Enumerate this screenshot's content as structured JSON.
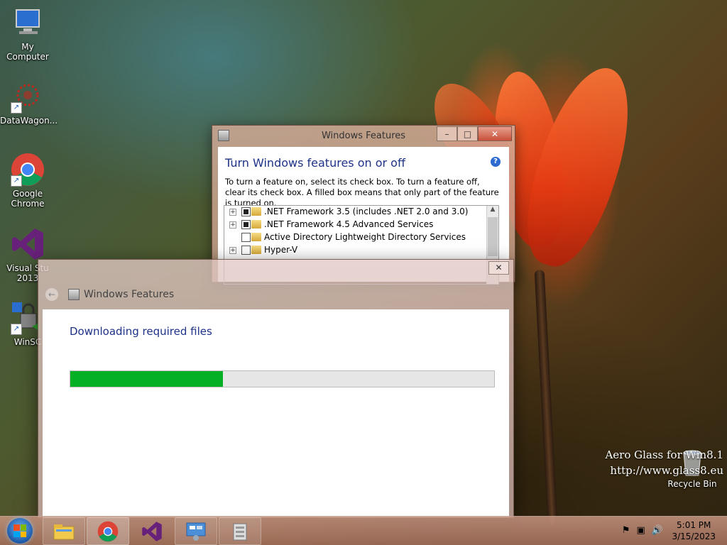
{
  "desktop": {
    "icons": [
      {
        "label": "My Computer",
        "icon": "computer-icon"
      },
      {
        "label": "DataWagon...",
        "icon": "datawagon-icon"
      },
      {
        "label": "Google\nChrome",
        "icon": "chrome-icon"
      },
      {
        "label": "Visual Stu\n2013",
        "icon": "visual-studio-icon"
      },
      {
        "label": "WinSC",
        "icon": "winscp-icon"
      }
    ],
    "recycle_bin": {
      "label": "Recycle Bin",
      "icon": "recycle-bin-icon"
    },
    "watermark": {
      "line1": "Aero Glass for Win8.1",
      "line2": "http://www.glass8.eu"
    }
  },
  "features_window": {
    "title": "Windows Features",
    "heading": "Turn Windows features on or off",
    "description": "To turn a feature on, select its check box. To turn a feature off, clear its check box. A filled box means that only part of the feature is turned on.",
    "features": [
      {
        "label": ".NET Framework 3.5 (includes .NET 2.0 and 3.0)",
        "expandable": true,
        "state": "partial"
      },
      {
        "label": ".NET Framework 4.5 Advanced Services",
        "expandable": true,
        "state": "partial"
      },
      {
        "label": "Active Directory Lightweight Directory Services",
        "expandable": false,
        "state": "off"
      },
      {
        "label": "Hyper-V",
        "expandable": true,
        "state": "off"
      }
    ],
    "caption_buttons": {
      "minimize": "–",
      "maximize": "□",
      "close": "✕"
    }
  },
  "download_dialog": {
    "title": "Windows Features",
    "message": "Downloading required files",
    "progress": 0.36,
    "close_glyph": "✕",
    "back_glyph": "←"
  },
  "taskbar": {
    "pinned": [
      "file-explorer-icon",
      "chrome-icon",
      "visual-studio-icon",
      "control-panel-icon",
      "windows-features-icon"
    ],
    "tray_icons": [
      "flag-icon",
      "network-icon",
      "volume-icon"
    ],
    "time": "5:01 PM",
    "date": "3/15/2023"
  },
  "colors": {
    "accent": "#1e3287",
    "progress": "#06b025"
  }
}
